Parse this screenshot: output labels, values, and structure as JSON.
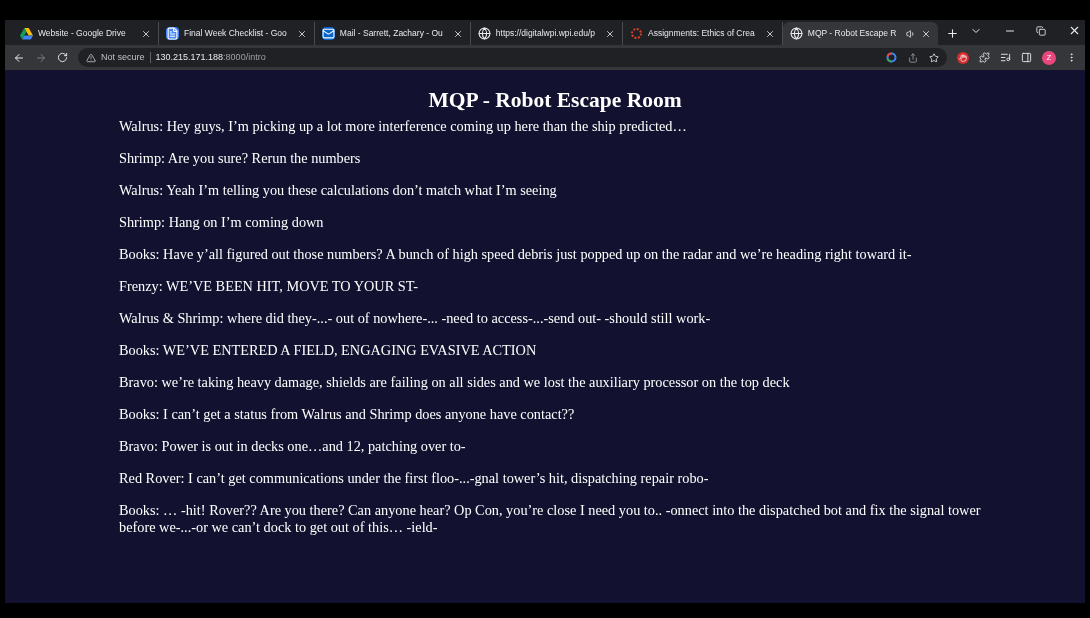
{
  "tabs": [
    {
      "title": "Website - Google Drive",
      "kind": "drive",
      "selected": false,
      "audio": false
    },
    {
      "title": "Final Week Checklist - Goo",
      "kind": "docs",
      "selected": false,
      "audio": false
    },
    {
      "title": "Mail - Sarrett, Zachary - Ou",
      "kind": "mail",
      "selected": false,
      "audio": false
    },
    {
      "title": "https://digitalwpi.wpi.edu/p",
      "kind": "globe",
      "selected": false,
      "audio": false
    },
    {
      "title": "Assignments: Ethics of Crea",
      "kind": "canvas",
      "selected": false,
      "audio": false
    },
    {
      "title": "MQP - Robot Escape R",
      "kind": "globe",
      "selected": true,
      "audio": true
    }
  ],
  "address_bar": {
    "security": "Not secure",
    "host": "130.215.171.188",
    "path": ":8000/intro"
  },
  "profile": {
    "initial": "Z"
  },
  "page": {
    "title": "MQP - Robot Escape Room",
    "lines": [
      "Walrus: Hey guys, I’m picking up a lot more interference coming up here than the ship predicted…",
      "Shrimp: Are you sure? Rerun the numbers",
      "Walrus: Yeah I’m telling you these calculations don’t match what I’m seeing",
      "Shrimp: Hang on I’m coming down",
      "Books: Have y’all figured out those numbers? A bunch of high speed debris just popped up on the radar and we’re heading right toward it-",
      "Frenzy: WE’VE BEEN HIT, MOVE TO YOUR ST-",
      "Walrus & Shrimp: where did they-...- out of nowhere-... -need to access-...-send out- -should still work-",
      "Books: WE’VE ENTERED A FIELD, ENGAGING EVASIVE ACTION",
      "Bravo: we’re taking heavy damage, shields are failing on all sides and we lost the auxiliary processor on the top deck",
      "Books: I can’t get a status from Walrus and Shrimp does anyone have contact??",
      "Bravo: Power is out in decks one…and 12, patching over to-",
      "Red Rover: I can’t get communications under the first floo-...-gnal tower’s hit, dispatching repair robo-",
      "Books: … -hit! Rover?? Are you there? Can anyone hear? Op Con, you’re close I need you to.. -onnect into the dispatched bot and fix the signal tower before we-...-or we can’t dock to get out of this… -ield-"
    ]
  }
}
